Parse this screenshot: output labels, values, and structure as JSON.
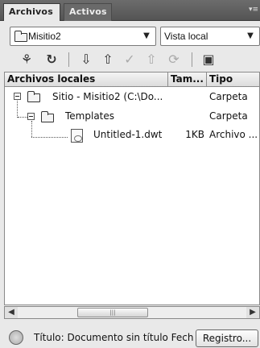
{
  "tabs": [
    {
      "label": "Archivos"
    },
    {
      "label": "Activos"
    }
  ],
  "site_select": {
    "value": "Misitio2"
  },
  "view_select": {
    "value": "Vista local"
  },
  "toolbar": {
    "connect_icon": "connect-icon",
    "refresh_icon": "refresh-icon",
    "get_icon": "get-files-icon",
    "put_icon": "put-files-icon",
    "checkout_icon": "check-out-icon",
    "checkin_icon": "check-in-icon",
    "sync_icon": "synchronize-icon",
    "expand_icon": "expand-panel-icon"
  },
  "columns": {
    "name": "Archivos locales",
    "size": "Tam...",
    "type": "Tipo"
  },
  "rows": [
    {
      "name": "Sitio - Misitio2 (C:\\Do...",
      "size": "",
      "type": "Carpeta"
    },
    {
      "name": "Templates",
      "size": "",
      "type": "Carpeta"
    },
    {
      "name": "Untitled-1.dwt",
      "size": "1KB",
      "type": "Archivo ..."
    }
  ],
  "status": {
    "text": "Título: Documento sin título  Fech",
    "button": "Registro..."
  },
  "colors": {
    "tab_bar": "#5f5f5f",
    "panel": "#e9e9e9"
  }
}
